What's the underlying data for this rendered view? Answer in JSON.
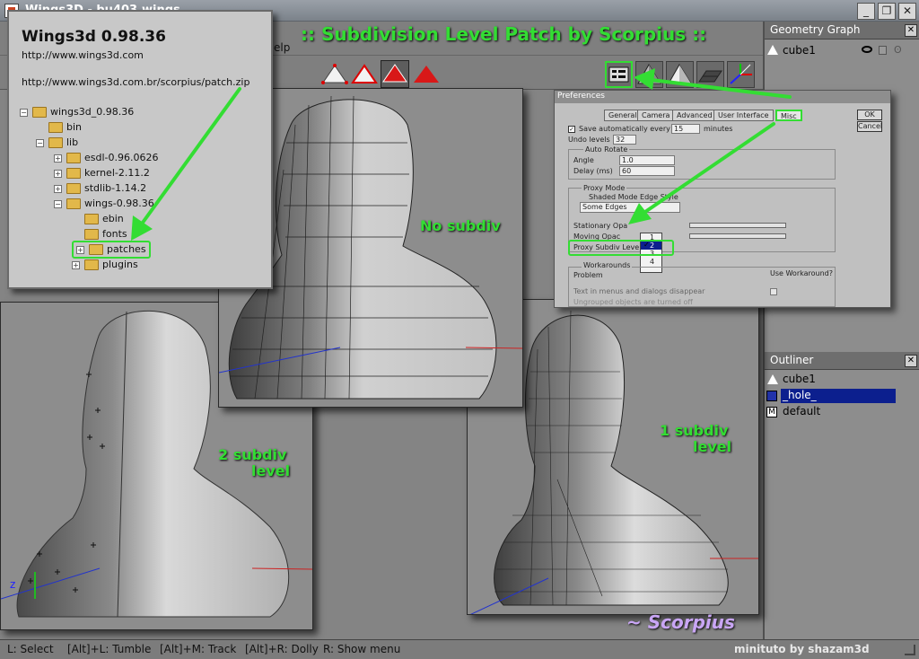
{
  "window": {
    "title": "Wings3D - bu403.wings",
    "min_label": "_",
    "max_label": "❐",
    "close_label": "✕"
  },
  "banner": {
    "text": ":: Subdivision Level Patch by Scorpius ::"
  },
  "menubar": {
    "partial_label": "elp"
  },
  "geometry_graph": {
    "title": "Geometry Graph",
    "close_label": "✕",
    "items": [
      {
        "label": "cube1"
      }
    ]
  },
  "outliner": {
    "title": "Outliner",
    "close_label": "✕",
    "items": [
      {
        "label": "cube1",
        "icon": "triangle-icon"
      },
      {
        "label": "_hole_",
        "icon": "image-icon",
        "selected": true
      },
      {
        "label": "default",
        "icon": "material-icon"
      }
    ]
  },
  "infocard": {
    "title": "Wings3d 0.98.36",
    "url": "http://www.wings3d.com",
    "patch_url": "http://www.wings3d.com.br/scorpius/patch.zip",
    "tree": [
      {
        "label": "wings3d_0.98.36",
        "toggle": "−"
      },
      {
        "label": "bin"
      },
      {
        "label": "lib",
        "toggle": "−"
      },
      {
        "label": "esdl-0.96.0626",
        "toggle": "+"
      },
      {
        "label": "kernel-2.11.2",
        "toggle": "+"
      },
      {
        "label": "stdlib-1.14.2",
        "toggle": "+"
      },
      {
        "label": "wings-0.98.36",
        "toggle": "−"
      },
      {
        "label": "ebin"
      },
      {
        "label": "fonts"
      },
      {
        "label": "patches",
        "toggle": "+"
      },
      {
        "label": "plugins",
        "toggle": "+"
      }
    ]
  },
  "labels": {
    "no_subdiv": "No subdiv",
    "two_subdiv_1": "2 subdiv",
    "two_subdiv_2": "level",
    "one_subdiv_1": "1 subdiv",
    "one_subdiv_2": "level",
    "signature": "~ Scorpius"
  },
  "preferences": {
    "title": "Preferences",
    "tabs": [
      "General",
      "Camera",
      "Advanced",
      "User Interface",
      "Misc"
    ],
    "ok_label": "OK",
    "cancel_label": "Cancel",
    "save_auto_label": "Save automatically every",
    "save_auto_value": "15",
    "minutes_label": "minutes",
    "undo_label": "Undo levels",
    "undo_value": "32",
    "auto_rotate_label": "Auto Rotate",
    "angle_label": "Angle",
    "angle_value": "1.0",
    "delay_label": "Delay (ms)",
    "delay_value": "60",
    "proxy_mode_label": "Proxy Mode",
    "edge_style_label": "Shaded Mode Edge Style",
    "edge_style_value": "Some Edges",
    "stationary_label": "Stationary Opa",
    "moving_label": "Moving Opac",
    "subdiv_label": "Proxy Subdiv Leve",
    "subdiv_options": [
      "1",
      "2",
      "3",
      "4"
    ],
    "subdiv_selected": "2",
    "workarounds_label": "Workarounds",
    "problem_label": "Problem",
    "use_workaround_label": "Use Workaround?",
    "text_disappear_label": "Text in menus and dialogs disappear",
    "ghost_label": "Ungrouped objects are turned off"
  },
  "status": {
    "select": "L: Select",
    "tumble": "[Alt]+L: Tumble",
    "track": "[Alt]+M: Track",
    "dolly": "[Alt]+R: Dolly",
    "menu": "R: Show menu",
    "credit": "minituto by shazam3d"
  },
  "colors": {
    "accent_green": "#33dd33",
    "signature": "#c9a6f5",
    "selection": "#0c1f8e"
  }
}
